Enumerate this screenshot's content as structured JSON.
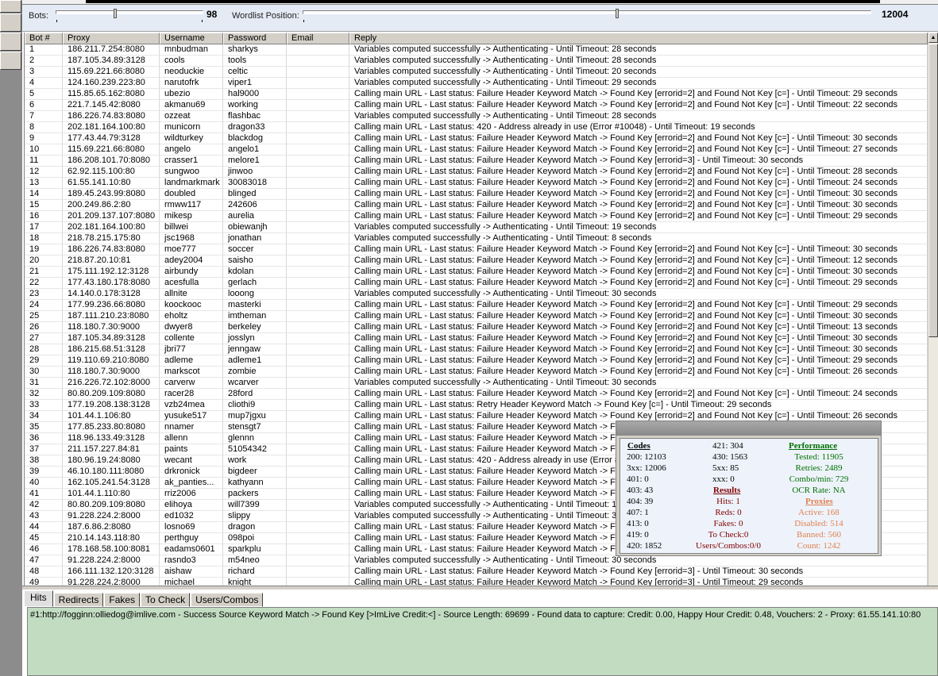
{
  "config": {
    "bots_label": "Bots:",
    "bots_value": "98",
    "bots_fraction": 0.39,
    "wordlist_label": "Wordlist Position:",
    "wordlist_value": "12004",
    "wordlist_fraction": 0.55
  },
  "table": {
    "columns": [
      "Bot #",
      "Proxy",
      "Username",
      "Password",
      "Email",
      "Reply"
    ],
    "rows": [
      [
        "1",
        "186.211.7.254:8080",
        "mnbudman",
        "sharkys",
        "",
        "Variables computed successfully -> Authenticating - Until Timeout: 28 seconds"
      ],
      [
        "2",
        "187.105.34.89:3128",
        "cools",
        "tools",
        "",
        "Variables computed successfully -> Authenticating - Until Timeout: 28 seconds"
      ],
      [
        "3",
        "115.69.221.66:8080",
        "neoduckie",
        "celtic",
        "",
        "Variables computed successfully -> Authenticating - Until Timeout: 20 seconds"
      ],
      [
        "4",
        "124.160.239.223:80",
        "narutofrk",
        "viper1",
        "",
        "Variables computed successfully -> Authenticating - Until Timeout: 29 seconds"
      ],
      [
        "5",
        "115.85.65.162:8080",
        "ubezio",
        "hal9000",
        "",
        "Calling main URL - Last status: Failure Header Keyword Match -> Found Key [errorid=2] and Found Not Key [c=] - Until Timeout: 29 seconds"
      ],
      [
        "6",
        "221.7.145.42:8080",
        "akmanu69",
        "working",
        "",
        "Calling main URL - Last status: Failure Header Keyword Match -> Found Key [errorid=2] and Found Not Key [c=] - Until Timeout: 22 seconds"
      ],
      [
        "7",
        "186.226.74.83:8080",
        "ozzeat",
        "flashbac",
        "",
        "Variables computed successfully -> Authenticating - Until Timeout: 28 seconds"
      ],
      [
        "8",
        "202.181.164.100:80",
        "municorn",
        "dragon33",
        "",
        "Calling main URL - Last status: 420 - Address already in use (Error #10048) - Until Timeout: 19 seconds"
      ],
      [
        "9",
        "177.43.44.79:3128",
        "wildturkey",
        "blackdog",
        "",
        "Calling main URL - Last status: Failure Header Keyword Match -> Found Key [errorid=2] and Found Not Key [c=] - Until Timeout: 30 seconds"
      ],
      [
        "10",
        "115.69.221.66:8080",
        "angelo",
        "angelo1",
        "",
        "Calling main URL - Last status: Failure Header Keyword Match -> Found Key [errorid=2] and Found Not Key [c=] - Until Timeout: 27 seconds"
      ],
      [
        "11",
        "186.208.101.70:8080",
        "crasser1",
        "melore1",
        "",
        "Calling main URL - Last status: Failure Header Keyword Match -> Found Key [errorid=3] - Until Timeout: 30 seconds"
      ],
      [
        "12",
        "62.92.115.100:80",
        "sungwoo",
        "jinwoo",
        "",
        "Calling main URL - Last status: Failure Header Keyword Match -> Found Key [errorid=2] and Found Not Key [c=] - Until Timeout: 28 seconds"
      ],
      [
        "13",
        "61.55.141.10:80",
        "landmarkmark",
        "30083018",
        "",
        "Calling main URL - Last status: Failure Header Keyword Match -> Found Key [errorid=2] and Found Not Key [c=] - Until Timeout: 24 seconds"
      ],
      [
        "14",
        "189.45.243.99:8080",
        "doubled",
        "blinged",
        "",
        "Calling main URL - Last status: Failure Header Keyword Match -> Found Key [errorid=2] and Found Not Key [c=] - Until Timeout: 30 seconds"
      ],
      [
        "15",
        "200.249.86.2:80",
        "rmww117",
        "242606",
        "",
        "Calling main URL - Last status: Failure Header Keyword Match -> Found Key [errorid=2] and Found Not Key [c=] - Until Timeout: 30 seconds"
      ],
      [
        "16",
        "201.209.137.107:8080",
        "mikesp",
        "aurelia",
        "",
        "Calling main URL - Last status: Failure Header Keyword Match -> Found Key [errorid=2] and Found Not Key [c=] - Until Timeout: 29 seconds"
      ],
      [
        "17",
        "202.181.164.100:80",
        "billwei",
        "obiewanjh",
        "",
        "Variables computed successfully -> Authenticating - Until Timeout: 19 seconds"
      ],
      [
        "18",
        "218.78.215.175:80",
        "jsc1968",
        "jonathan",
        "",
        "Variables computed successfully -> Authenticating - Until Timeout: 8 seconds"
      ],
      [
        "19",
        "186.226.74.83:8080",
        "moe777",
        "soccer",
        "",
        "Calling main URL - Last status: Failure Header Keyword Match -> Found Key [errorid=2] and Found Not Key [c=] - Until Timeout: 30 seconds"
      ],
      [
        "20",
        "218.87.20.10:81",
        "adey2004",
        "saisho",
        "",
        "Calling main URL - Last status: Failure Header Keyword Match -> Found Key [errorid=2] and Found Not Key [c=] - Until Timeout: 12 seconds"
      ],
      [
        "21",
        "175.111.192.12:3128",
        "airbundy",
        "kdolan",
        "",
        "Calling main URL - Last status: Failure Header Keyword Match -> Found Key [errorid=2] and Found Not Key [c=] - Until Timeout: 30 seconds"
      ],
      [
        "22",
        "177.43.180.178:8080",
        "acesfulla",
        "gerlach",
        "",
        "Calling main URL - Last status: Failure Header Keyword Match -> Found Key [errorid=2] and Found Not Key [c=] - Until Timeout: 29 seconds"
      ],
      [
        "23",
        "14.140.0.178:3128",
        "allnite",
        "looong",
        "",
        "Variables computed successfully -> Authenticating - Until Timeout: 30 seconds"
      ],
      [
        "24",
        "177.99.236.66:8080",
        "koockooc",
        "masterki",
        "",
        "Calling main URL - Last status: Failure Header Keyword Match -> Found Key [errorid=2] and Found Not Key [c=] - Until Timeout: 29 seconds"
      ],
      [
        "25",
        "187.111.210.23:8080",
        "eholtz",
        "imtheman",
        "",
        "Calling main URL - Last status: Failure Header Keyword Match -> Found Key [errorid=2] and Found Not Key [c=] - Until Timeout: 30 seconds"
      ],
      [
        "26",
        "118.180.7.30:9000",
        "dwyer8",
        "berkeley",
        "",
        "Calling main URL - Last status: Failure Header Keyword Match -> Found Key [errorid=2] and Found Not Key [c=] - Until Timeout: 13 seconds"
      ],
      [
        "27",
        "187.105.34.89:3128",
        "collente",
        "josslyn",
        "",
        "Calling main URL - Last status: Failure Header Keyword Match -> Found Key [errorid=2] and Found Not Key [c=] - Until Timeout: 30 seconds"
      ],
      [
        "28",
        "186.215.68.51:3128",
        "jbri77",
        "jenngaw",
        "",
        "Calling main URL - Last status: Failure Header Keyword Match -> Found Key [errorid=2] and Found Not Key [c=] - Until Timeout: 30 seconds"
      ],
      [
        "29",
        "119.110.69.210:8080",
        "adleme",
        "adleme1",
        "",
        "Calling main URL - Last status: Failure Header Keyword Match -> Found Key [errorid=2] and Found Not Key [c=] - Until Timeout: 29 seconds"
      ],
      [
        "30",
        "118.180.7.30:9000",
        "markscot",
        "zombie",
        "",
        "Calling main URL - Last status: Failure Header Keyword Match -> Found Key [errorid=2] and Found Not Key [c=] - Until Timeout: 26 seconds"
      ],
      [
        "31",
        "216.226.72.102:8000",
        "carverw",
        "wcarver",
        "",
        "Variables computed successfully -> Authenticating - Until Timeout: 30 seconds"
      ],
      [
        "32",
        "80.80.209.109:8080",
        "racer28",
        "28ford",
        "",
        "Calling main URL - Last status: Failure Header Keyword Match -> Found Key [errorid=2] and Found Not Key [c=] - Until Timeout: 24 seconds"
      ],
      [
        "33",
        "177.19.208.138:3128",
        "vzb24mea",
        "cliothi9",
        "",
        "Calling main URL - Last status: Retry Header Keyword Match -> Found Key [c=] - Until Timeout: 29 seconds"
      ],
      [
        "34",
        "101.44.1.106:80",
        "yusuke517",
        "mup7jgxu",
        "",
        "Calling main URL - Last status: Failure Header Keyword Match -> Found Key [errorid=2] and Found Not Key [c=] - Until Timeout: 26 seconds"
      ],
      [
        "35",
        "177.85.233.80:8080",
        "nnamer",
        "stensgt7",
        "",
        "Calling main URL - Last status: Failure Header Keyword Match -> Fo"
      ],
      [
        "36",
        "118.96.133.49:3128",
        "allenn",
        "glennn",
        "",
        "Calling main URL - Last status: Failure Header Keyword Match -> Fo"
      ],
      [
        "37",
        "211.157.227.84:81",
        "paints",
        "51054342",
        "",
        "Calling main URL - Last status: Failure Header Keyword Match -> Fo"
      ],
      [
        "38",
        "180.96.19.24:8080",
        "wecant",
        "work",
        "",
        "Calling main URL - Last status: 420 - Address already in use (Error #1"
      ],
      [
        "39",
        "46.10.180.111:8080",
        "drkronick",
        "bigdeer",
        "",
        "Calling main URL - Last status: Failure Header Keyword Match -> Fo"
      ],
      [
        "40",
        "162.105.241.54:3128",
        "ak_panties...",
        "kathyann",
        "",
        "Calling main URL - Last status: Failure Header Keyword Match -> Fo"
      ],
      [
        "41",
        "101.44.1.110:80",
        "rriz2006",
        "packers",
        "",
        "Calling main URL - Last status: Failure Header Keyword Match -> Fo"
      ],
      [
        "42",
        "80.80.209.109:8080",
        "elihoya",
        "will7399",
        "",
        "Variables computed successfully -> Authenticating - Until Timeout: 17"
      ],
      [
        "43",
        "91.228.224.2:8000",
        "ed1032",
        "slippy",
        "",
        "Variables computed successfully -> Authenticating - Until Timeout: 3"
      ],
      [
        "44",
        "187.6.86.2:8080",
        "losno69",
        "dragon",
        "",
        "Calling main URL - Last status: Failure Header Keyword Match -> Fo"
      ],
      [
        "45",
        "210.14.143.118:80",
        "perthguy",
        "098poi",
        "",
        "Calling main URL - Last status: Failure Header Keyword Match -> Fo"
      ],
      [
        "46",
        "178.168.58.100:8081",
        "eadams0601",
        "sparkplu",
        "",
        "Calling main URL - Last status: Failure Header Keyword Match -> Fo"
      ],
      [
        "47",
        "91.228.224.2:8000",
        "rasndo3",
        "m54neo",
        "",
        "Variables computed successfully -> Authenticating - Until Timeout: 30 seconds"
      ],
      [
        "48",
        "166.111.132.120:3128",
        "aishaw",
        "richard",
        "",
        "Calling main URL - Last status: Failure Header Keyword Match -> Found Key [errorid=3] - Until Timeout: 30 seconds"
      ],
      [
        "49",
        "91.228.224.2:8000",
        "michael",
        "knight",
        "",
        "Calling main URL - Last status: Failure Header Keyword Match -> Found Key [errorid=3] - Until Timeout: 29 seconds"
      ]
    ]
  },
  "stats": {
    "codes_header": "Codes",
    "codes": [
      "200: 12103",
      "3xx: 12006",
      "401: 0",
      "403: 43",
      "404: 39",
      "407: 1",
      "413: 0",
      "419: 0",
      "420: 1852"
    ],
    "codes2": [
      "421: 304",
      "430: 1563",
      "5xx: 85",
      "xxx: 0"
    ],
    "results_header": "Results",
    "results": [
      "Hits: 1",
      "Reds: 0",
      "Fakes: 0",
      "To Check:0",
      "Users/Combos:0/0"
    ],
    "performance_header": "Performance",
    "performance": [
      "Tested: 11905",
      "Retries: 2489",
      "Combo/min: 729",
      "OCR Rate: NA"
    ],
    "proxies_header": "Proxies",
    "proxies": [
      "Active: 168",
      "Disabled: 514",
      "Banned: 560",
      "Count: 1242"
    ],
    "colors": {
      "codes": "#000000",
      "results": "#800000",
      "performance": "#007000",
      "proxies": "#e08050"
    }
  },
  "bottom": {
    "tabs": [
      "Hits",
      "Redirects",
      "Fakes",
      "To Check",
      "Users/Combos"
    ],
    "active_tab": "Hits",
    "output": "#1:http://fogginn:olliedog@imlive.com - Success Source Keyword Match -> Found Key [>ImLive Credit:<] - Source Length: 69699 - Found data to capture: Credit: 0.00, Happy Hour Credit: 0.48, Vouchers: 2 - Proxy: 61.55.141.10:80"
  }
}
